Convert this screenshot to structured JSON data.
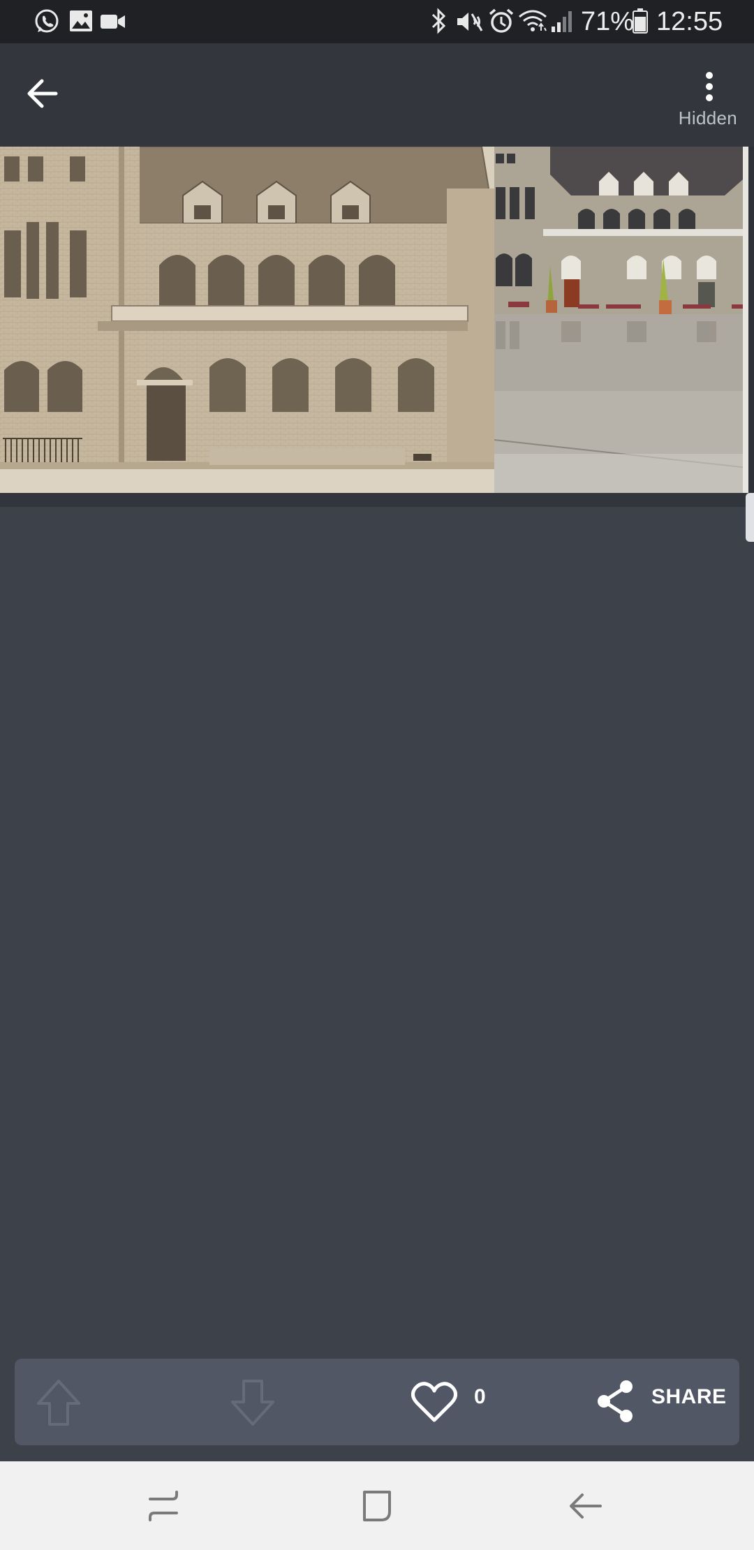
{
  "status_bar": {
    "left_icons": [
      "whatsapp-icon",
      "gallery-icon",
      "video-camera-icon"
    ],
    "right_icons": [
      "bluetooth-icon",
      "mute-icon",
      "alarm-icon",
      "wifi-icon",
      "signal-icon",
      "battery-icon"
    ],
    "battery": "71%",
    "time": "12:55"
  },
  "app_bar": {
    "back_icon": "arrow-left-icon",
    "menu_icon": "more-vert-icon",
    "menu_label": "Hidden"
  },
  "images": {
    "left": "historic-sepia-building-photo",
    "right": "modern-color-building-photo"
  },
  "actions": {
    "up_icon": "arrow-up-outline-icon",
    "down_icon": "arrow-down-outline-icon",
    "like_icon": "heart-outline-icon",
    "like_count": "0",
    "share_icon": "share-icon",
    "share_label": "SHARE"
  },
  "nav_bar": {
    "recents_icon": "recents-icon",
    "home_icon": "home-icon",
    "back_icon": "back-icon"
  },
  "colors": {
    "page_background": "#3d414a",
    "app_bar": "#33363d",
    "status_bar": "#1f2125",
    "action_bar": "#525765",
    "nav_bar": "#f1f1f1"
  }
}
